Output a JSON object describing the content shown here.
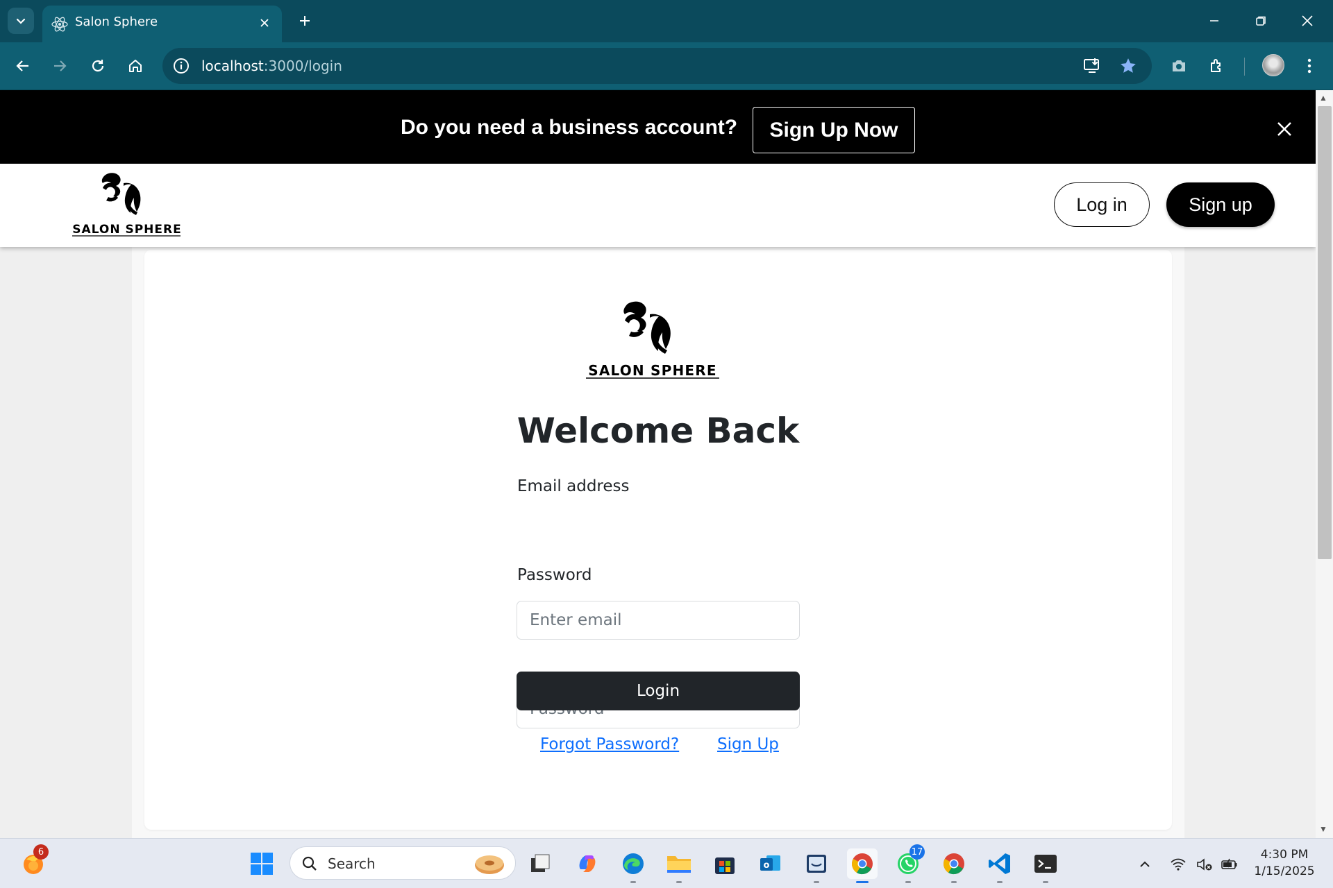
{
  "browser": {
    "tab_title": "Salon Sphere",
    "url_host": "localhost",
    "url_path": ":3000/login"
  },
  "promo": {
    "text": "Do you need a business account?",
    "button": "Sign Up Now"
  },
  "header": {
    "brand": "SALON SPHERE",
    "login_button": "Log in",
    "signup_button": "Sign up"
  },
  "login_card": {
    "brand": "SALON SPHERE",
    "title": "Welcome Back",
    "email_label": "Email address",
    "email_placeholder": "Enter email",
    "password_label": "Password",
    "password_placeholder": "Password",
    "submit": "Login",
    "forgot_link": "Forgot Password?",
    "signup_link": "Sign Up"
  },
  "taskbar": {
    "search_placeholder": "Search",
    "firefox_badge": "6",
    "whatsapp_badge": "17",
    "time": "4:30 PM",
    "date": "1/15/2025",
    "icons": [
      "start-icon",
      "search-icon",
      "file-manager-icon",
      "copilot-icon",
      "edge-icon",
      "explorer-icon",
      "store-icon",
      "outlook-icon",
      "teams-icon",
      "chrome-icon",
      "whatsapp-icon",
      "chrome-profile-icon",
      "vscode-icon",
      "terminal-icon"
    ]
  },
  "colors": {
    "chrome_tabbar": "#0b4a5c",
    "chrome_toolbar": "#0f5f73",
    "promo_bg": "#000000",
    "primary_button": "#212529",
    "link": "#0d6efd"
  }
}
